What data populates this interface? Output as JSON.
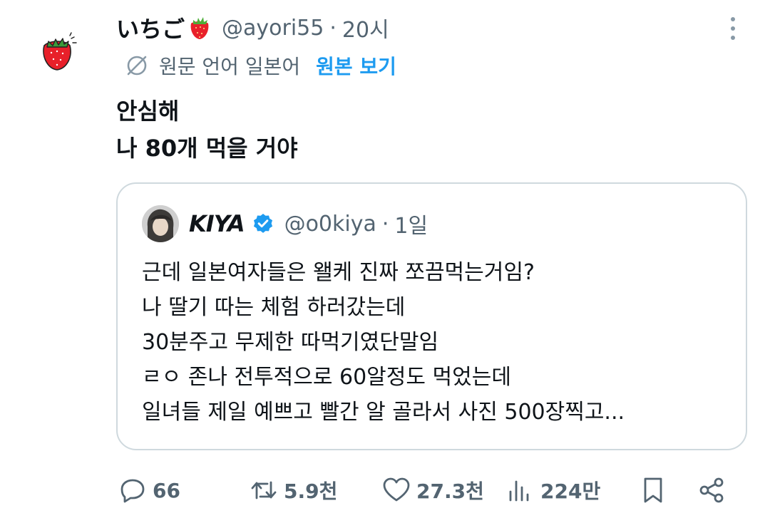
{
  "author": {
    "display_name": "いちご",
    "handle": "@ayori55",
    "separator": "·",
    "time": "20시"
  },
  "translation": {
    "label": "원문 언어 일본어",
    "show_original": "원본 보기"
  },
  "tweet": {
    "lines": [
      "안심해",
      "나 80개 먹을 거야"
    ]
  },
  "quote": {
    "display_name": "KIYA",
    "handle": "@o0kiya",
    "separator": "·",
    "time": "1일",
    "lines": [
      "근데 일본여자들은 왤케 진짜 쪼끔먹는거임?",
      "나 딸기 따는 체험 하러갔는데",
      "30분주고 무제한 따먹기였단말임",
      "ㄹㅇ 존나 전투적으로 60알정도 먹었는데",
      "일녀들 제일 예쁘고 빨간 알 골라서 사진 500장찍고..."
    ]
  },
  "actions": {
    "replies": "66",
    "retweets": "5.9천",
    "likes": "27.3천",
    "views": "224만"
  },
  "icons": {
    "more": "more-vertical-icon",
    "translate": "translate-globe-icon",
    "verified": "verified-badge-icon",
    "reply": "reply-icon",
    "retweet": "retweet-icon",
    "like": "heart-icon",
    "views": "views-chart-icon",
    "bookmark": "bookmark-icon",
    "share": "share-icon"
  },
  "colors": {
    "text": "#0f1419",
    "secondary": "#536471",
    "link": "#1d9bf0",
    "border": "#cfd9de",
    "verified": "#1d9bf0",
    "strawberry": "#e8202a"
  }
}
